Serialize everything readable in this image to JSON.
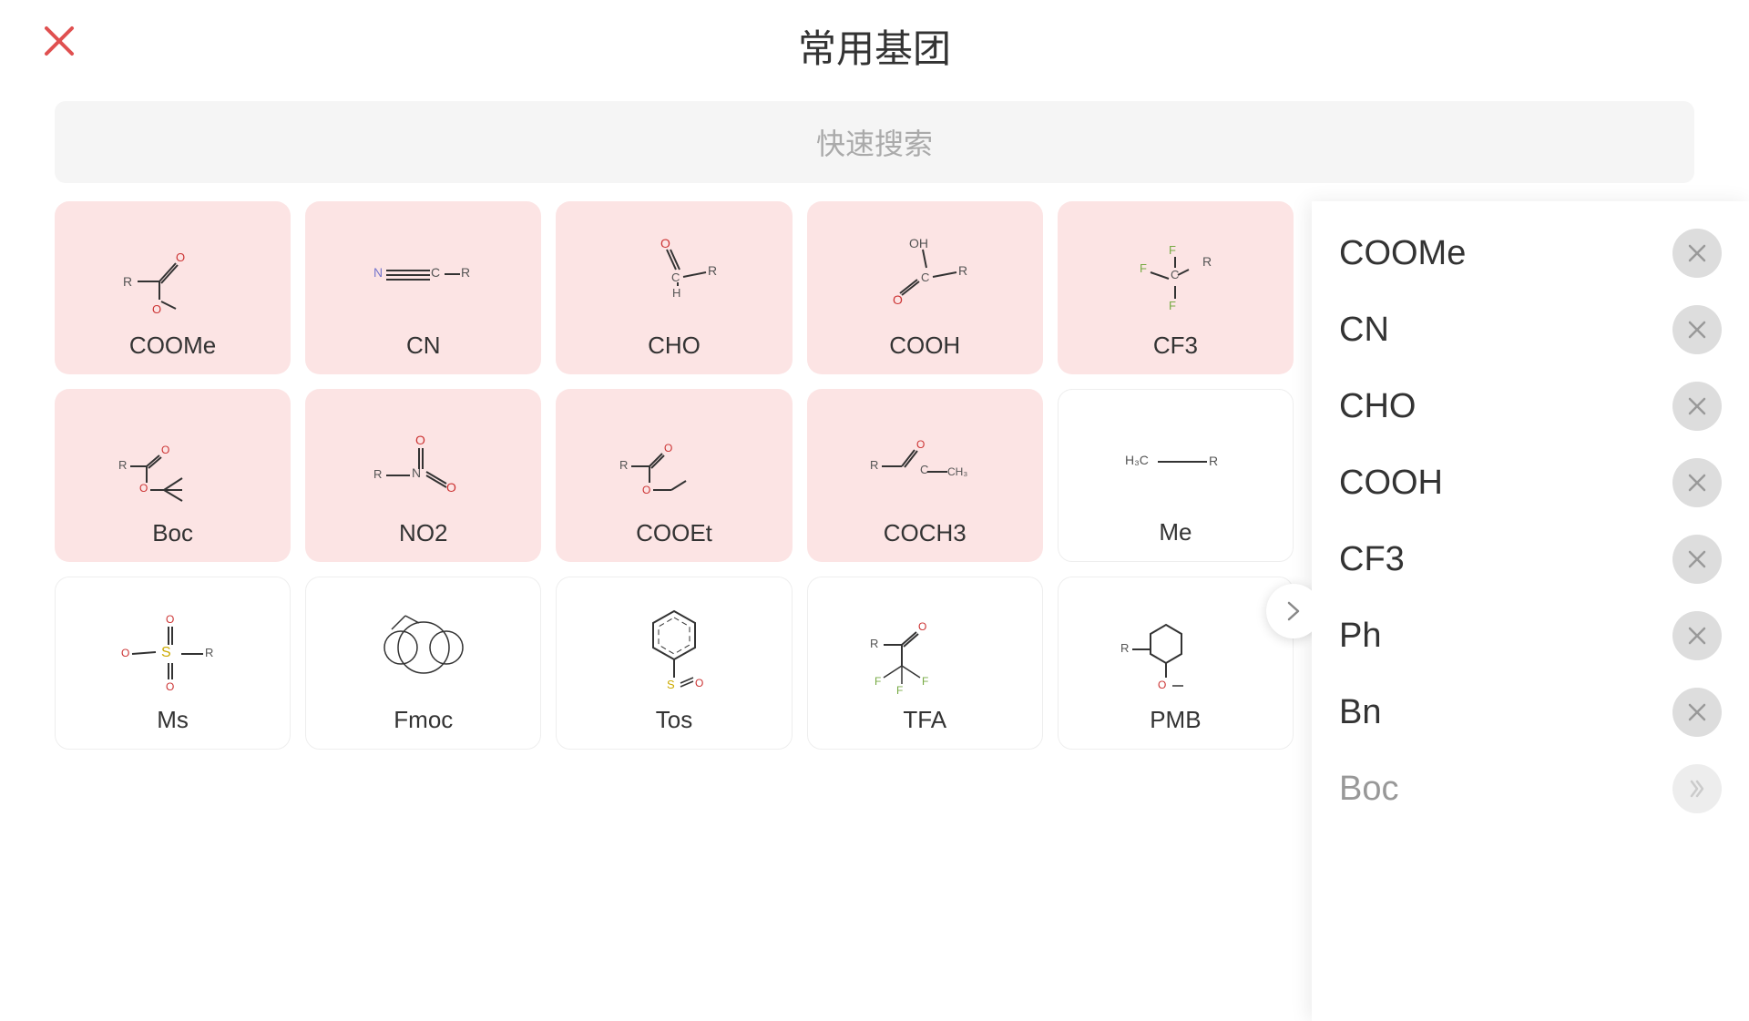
{
  "header": {
    "title": "常用基团",
    "close_label": "close"
  },
  "search": {
    "placeholder": "快速搜索"
  },
  "grid": {
    "items": [
      {
        "id": "coome",
        "label": "COOMe",
        "bg": "pink"
      },
      {
        "id": "cn",
        "label": "CN",
        "bg": "pink"
      },
      {
        "id": "cho",
        "label": "CHO",
        "bg": "pink"
      },
      {
        "id": "cooh",
        "label": "COOH",
        "bg": "pink"
      },
      {
        "id": "cf3",
        "label": "CF3",
        "bg": "pink"
      },
      {
        "id": "boc",
        "label": "Boc",
        "bg": "pink"
      },
      {
        "id": "no2",
        "label": "NO2",
        "bg": "pink"
      },
      {
        "id": "cooet",
        "label": "COOEt",
        "bg": "pink"
      },
      {
        "id": "coch3",
        "label": "COCH3",
        "bg": "pink"
      },
      {
        "id": "me",
        "label": "Me",
        "bg": "white"
      },
      {
        "id": "ms",
        "label": "Ms",
        "bg": "white"
      },
      {
        "id": "fmoc",
        "label": "Fmoc",
        "bg": "white"
      },
      {
        "id": "tos",
        "label": "Tos",
        "bg": "white"
      },
      {
        "id": "tfa",
        "label": "TFA",
        "bg": "white"
      },
      {
        "id": "pmb",
        "label": "PMB",
        "bg": "white"
      }
    ]
  },
  "panel": {
    "items": [
      {
        "id": "coome",
        "label": "COOMe"
      },
      {
        "id": "cn",
        "label": "CN"
      },
      {
        "id": "cho",
        "label": "CHO"
      },
      {
        "id": "cooh",
        "label": "COOH"
      },
      {
        "id": "cf3",
        "label": "CF3"
      },
      {
        "id": "ph",
        "label": "Ph"
      },
      {
        "id": "bn",
        "label": "Bn"
      },
      {
        "id": "boc_panel",
        "label": "Boc"
      }
    ]
  },
  "arrow": "›"
}
